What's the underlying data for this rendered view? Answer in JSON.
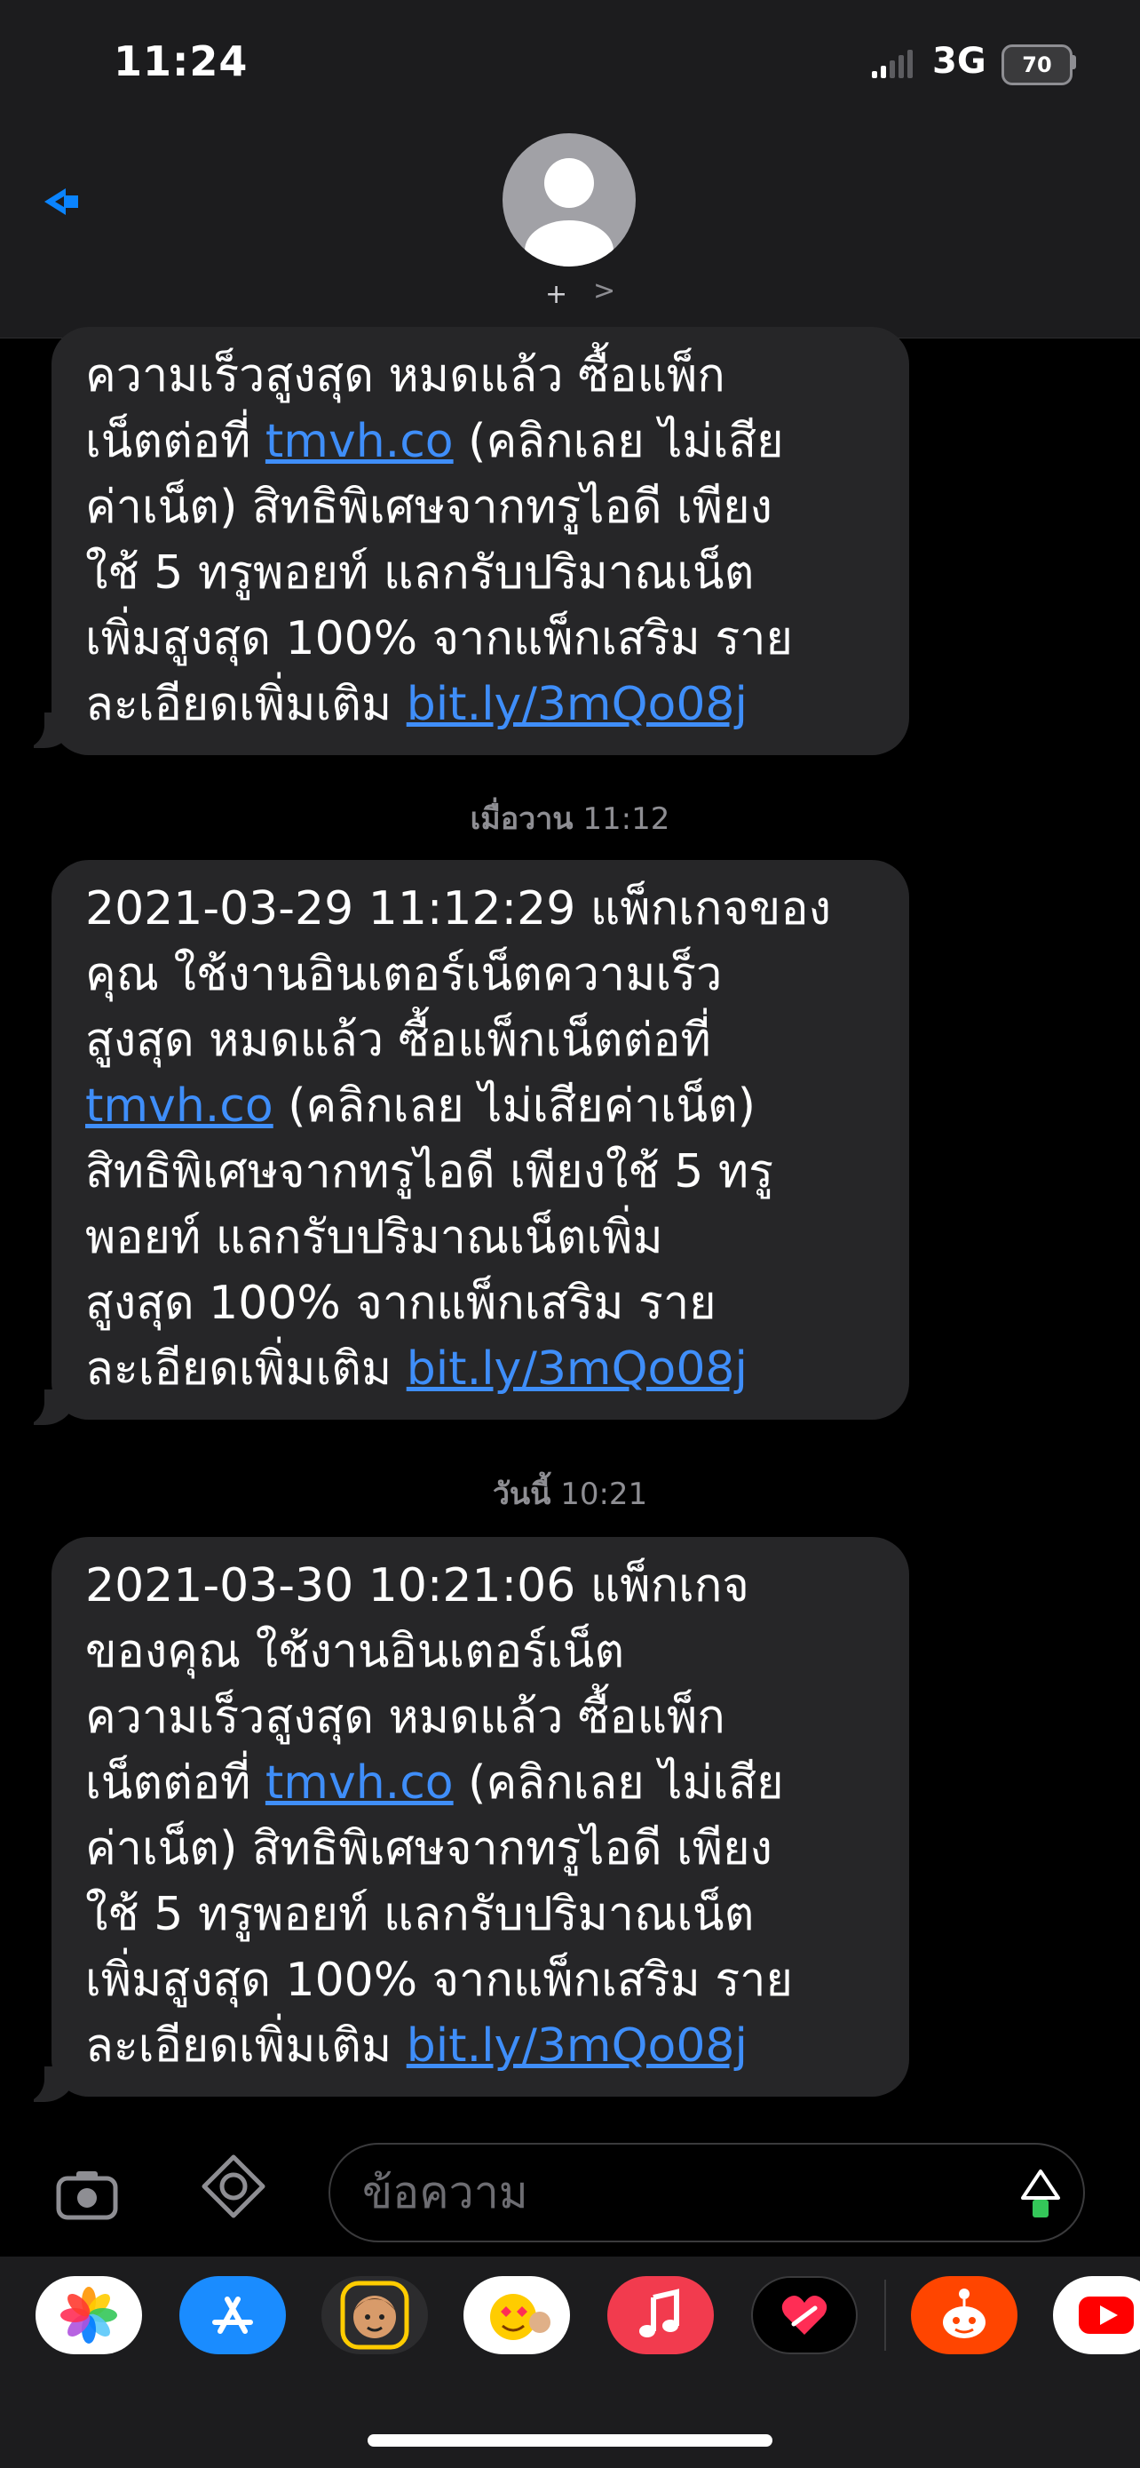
{
  "status_bar": {
    "time": "11:24",
    "network": "3G",
    "battery": "70"
  },
  "header": {
    "add_symbol": "+",
    "chevron": ">"
  },
  "messages": [
    {
      "lines": [
        [
          {
            "t": "ความเร็วสูงสุด หมดแล้ว ซื้อแพ็ก"
          }
        ],
        [
          {
            "t": "เน็ตต่อที่ "
          },
          {
            "t": "tmvh.co",
            "link": true
          },
          {
            "t": " (คลิกเลย ไม่เสีย"
          }
        ],
        [
          {
            "t": "ค่าเน็ต) สิทธิพิเศษจากทรูไอดี เพียง"
          }
        ],
        [
          {
            "t": "ใช้ 5 ทรูพอยท์ แลกรับปริมาณเน็ต"
          }
        ],
        [
          {
            "t": "เพิ่มสูงสุด 100% จากแพ็กเสริม ราย"
          }
        ],
        [
          {
            "t": "ละเอียดเพิ่มเติม "
          },
          {
            "t": "bit.ly/3mQo08j",
            "link": true
          }
        ]
      ]
    },
    {
      "timestamp_day": "เมื่อวาน",
      "timestamp_time": "11:12",
      "lines": [
        [
          {
            "t": "2021-03-29 11:12:29 แพ็กเกจของ"
          }
        ],
        [
          {
            "t": "คุณ ใช้งานอินเตอร์เน็ตความเร็ว"
          }
        ],
        [
          {
            "t": "สูงสุด หมดแล้ว ซื้อแพ็กเน็ตต่อที่"
          }
        ],
        [
          {
            "t": "tmvh.co",
            "link": true
          },
          {
            "t": " (คลิกเลย ไม่เสียค่าเน็ต)"
          }
        ],
        [
          {
            "t": "สิทธิพิเศษจากทรูไอดี เพียงใช้ 5 ทรู"
          }
        ],
        [
          {
            "t": "พอยท์ แลกรับปริมาณเน็ตเพิ่ม"
          }
        ],
        [
          {
            "t": "สูงสุด 100% จากแพ็กเสริม ราย"
          }
        ],
        [
          {
            "t": "ละเอียดเพิ่มเติม "
          },
          {
            "t": "bit.ly/3mQo08j",
            "link": true
          }
        ]
      ]
    },
    {
      "timestamp_day": "วันนี้",
      "timestamp_time": "10:21",
      "lines": [
        [
          {
            "t": "2021-03-30 10:21:06 แพ็กเกจ"
          }
        ],
        [
          {
            "t": "ของคุณ ใช้งานอินเตอร์เน็ต"
          }
        ],
        [
          {
            "t": "ความเร็วสูงสุด หมดแล้ว ซื้อแพ็ก"
          }
        ],
        [
          {
            "t": "เน็ตต่อที่ "
          },
          {
            "t": "tmvh.co",
            "link": true
          },
          {
            "t": " (คลิกเลย ไม่เสีย"
          }
        ],
        [
          {
            "t": "ค่าเน็ต) สิทธิพิเศษจากทรูไอดี เพียง"
          }
        ],
        [
          {
            "t": "ใช้ 5 ทรูพอยท์ แลกรับปริมาณเน็ต"
          }
        ],
        [
          {
            "t": "เพิ่มสูงสุด 100% จากแพ็กเสริม ราย"
          }
        ],
        [
          {
            "t": "ละเอียดเพิ่มเติม "
          },
          {
            "t": "bit.ly/3mQo08j",
            "link": true
          }
        ]
      ]
    }
  ],
  "compose": {
    "placeholder": "ข้อความ"
  },
  "app_drawer": [
    {
      "icon": "photos-icon"
    },
    {
      "icon": "app-store-icon"
    },
    {
      "icon": "memoji-icon"
    },
    {
      "icon": "animoji-icon"
    },
    {
      "icon": "music-icon"
    },
    {
      "icon": "digital-touch-icon"
    },
    {
      "icon": "reddit-icon"
    },
    {
      "icon": "youtube-icon"
    }
  ],
  "colors": {
    "link": "#3f8ef9",
    "bubble": "#262628",
    "background": "#000000",
    "header": "#1c1c1e"
  }
}
